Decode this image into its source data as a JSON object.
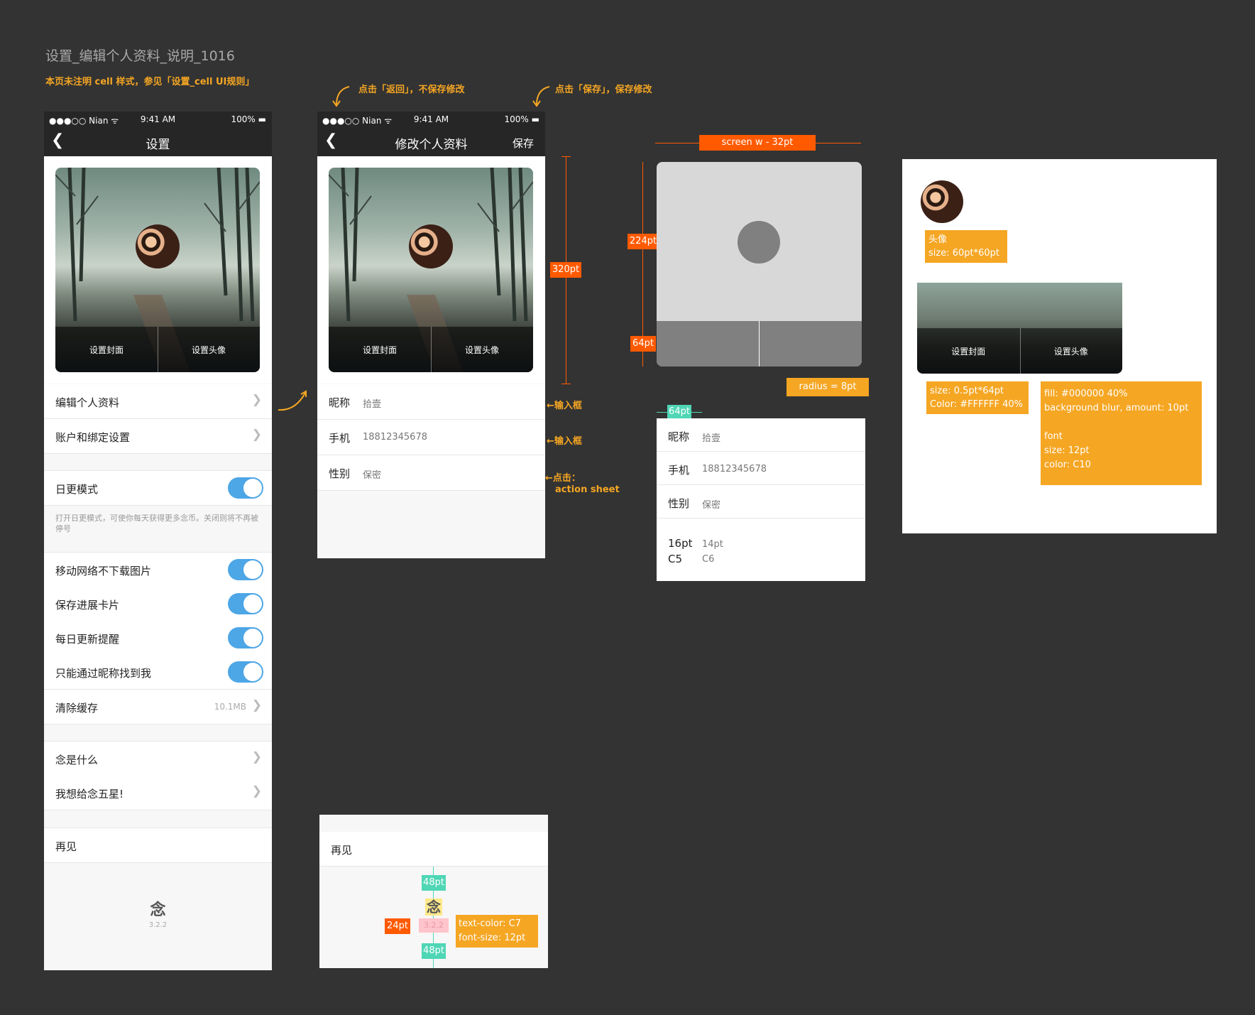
{
  "page": {
    "title": "设置_编辑个人资料_说明_1016",
    "note": "本页未注明 cell 样式，参见「设置_cell UI规则」"
  },
  "annotations": {
    "back": "点击「返回」，不保存修改",
    "save": "点击「保存」，保存修改",
    "input1": "←输入框",
    "input2": "←输入框",
    "tap": "←点击：",
    "action_sheet": "action sheet",
    "h320": "320pt",
    "screen_w": "screen w - 32pt",
    "h224": "224pt",
    "h64": "64pt",
    "radius": "radius = 8pt",
    "w64": "64pt",
    "avatar_title": "头像",
    "avatar_size": "size: 60pt*60pt",
    "divider_size": "size: 0.5pt*64pt",
    "divider_color": "Color: #FFFFFF 40%",
    "bar_fill": "fill: #000000 40%",
    "bar_blur": "background blur, amount: 10pt",
    "bar_font": "font",
    "bar_font_size": "size: 12pt",
    "bar_font_color": "color: C10",
    "gap48_top": "48pt",
    "gap24": "24pt",
    "gap48_bottom": "48pt",
    "text_color": "text-color: C7",
    "font_size": "font-size: 12pt",
    "font_spec_left_size": "16pt",
    "font_spec_left_color": "C5",
    "font_spec_right_size": "14pt",
    "font_spec_right_color": "C6"
  },
  "statusbar": {
    "carrier": "●●●○○ Nian ᯤ",
    "time": "9:41 AM",
    "battery": "100% ▬"
  },
  "settings_screen": {
    "title": "设置",
    "set_cover": "设置封面",
    "set_avatar": "设置头像",
    "edit_profile": "编辑个人资料",
    "account_binding": "账户和绑定设置",
    "daily_mode": "日更模式",
    "daily_mode_note": "打开日更模式，可使你每天获得更多念币。关闭则将不再被停号",
    "no_images_mobile": "移动网络不下载图片",
    "save_progress_card": "保存进展卡片",
    "daily_reminder": "每日更新提醒",
    "find_by_nickname": "只能通过昵称找到我",
    "clear_cache": "清除缓存",
    "cache_size": "10.1MB",
    "what_is_nian": "念是什么",
    "rate_five_stars": "我想给念五星!",
    "goodbye": "再见",
    "logo": "念",
    "version": "3.2.2"
  },
  "edit_screen": {
    "title": "修改个人资料",
    "save": "保存",
    "set_cover": "设置封面",
    "set_avatar": "设置头像",
    "nickname_label": "昵称",
    "nickname_value": "拾壹",
    "phone_label": "手机",
    "phone_value": "18812345678",
    "gender_label": "性别",
    "gender_value": "保密"
  },
  "spec_list": {
    "nickname_label": "昵称",
    "nickname_value": "拾壹",
    "phone_label": "手机",
    "phone_value": "18812345678",
    "gender_label": "性别",
    "gender_value": "保密"
  },
  "spec_cover": {
    "set_cover": "设置封面",
    "set_avatar": "设置头像"
  },
  "footer_spec": {
    "goodbye": "再见",
    "logo": "念",
    "version": "3.2.2"
  },
  "colors": {
    "background": "#333333",
    "accent_orange": "#ff5a00",
    "annotation_amber": "#f5a623",
    "measure_teal": "#4fd6b5",
    "toggle_blue": "#4da6e6"
  }
}
